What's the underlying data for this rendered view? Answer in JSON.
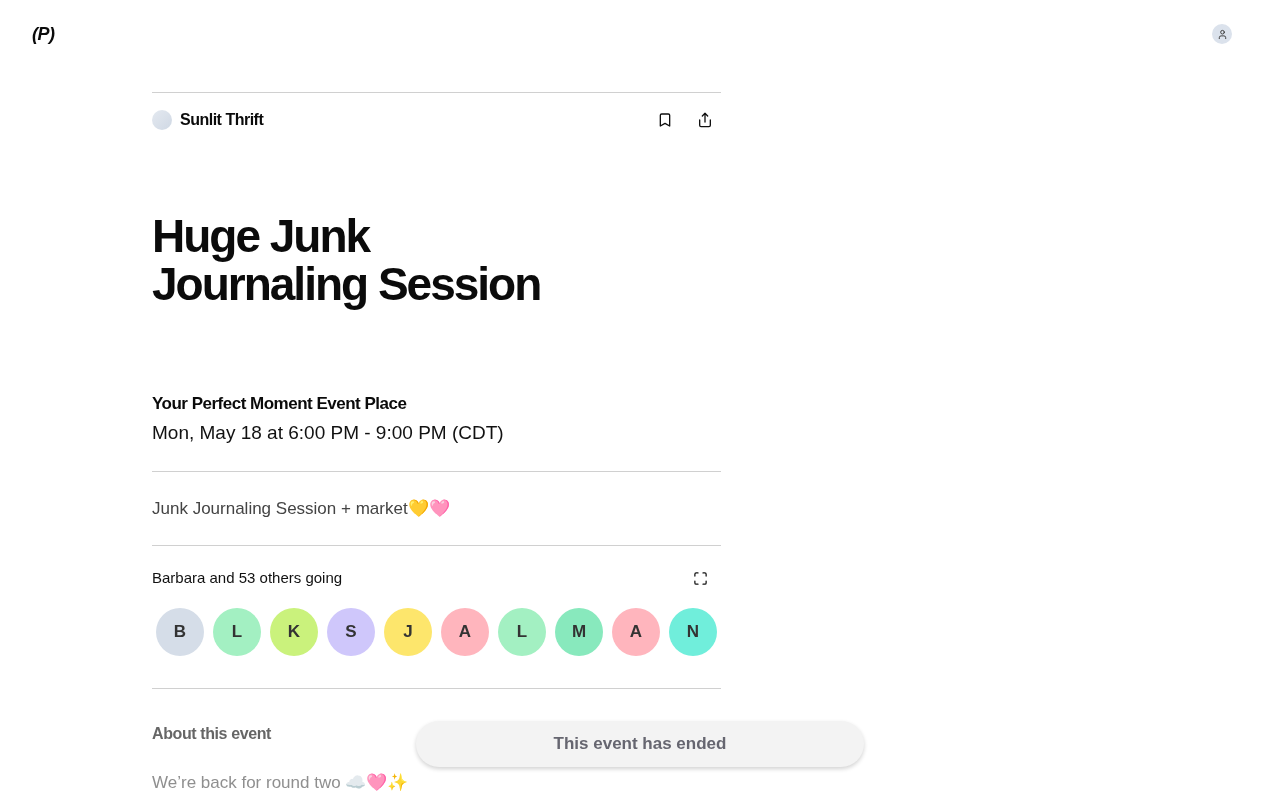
{
  "header": {
    "logo": "(P)"
  },
  "host": {
    "name": "Sunlit Thrift"
  },
  "event": {
    "title": "Huge Junk Journaling Session",
    "venue": "Your Perfect Moment Event Place",
    "datetime": "Mon, May 18 at 6:00 PM - 9:00 PM (CDT)",
    "summary": "Junk Journaling Session + market💛🩷"
  },
  "attendance": {
    "summary": "Barbara and 53 others going",
    "attendees": [
      {
        "initial": "B",
        "color": "#d5dde8"
      },
      {
        "initial": "L",
        "color": "#a3f0c2"
      },
      {
        "initial": "K",
        "color": "#caf27c"
      },
      {
        "initial": "S",
        "color": "#cfc7fb"
      },
      {
        "initial": "J",
        "color": "#fde66c"
      },
      {
        "initial": "A",
        "color": "#ffb5bd"
      },
      {
        "initial": "L",
        "color": "#a3f0c2"
      },
      {
        "initial": "M",
        "color": "#88e9bd"
      },
      {
        "initial": "A",
        "color": "#ffb5bd"
      },
      {
        "initial": "N",
        "color": "#70eedb"
      }
    ]
  },
  "about": {
    "heading": "About this event",
    "text": "We’re back for round two ☁️🩷✨"
  },
  "status_banner": {
    "text": "This event has ended"
  }
}
